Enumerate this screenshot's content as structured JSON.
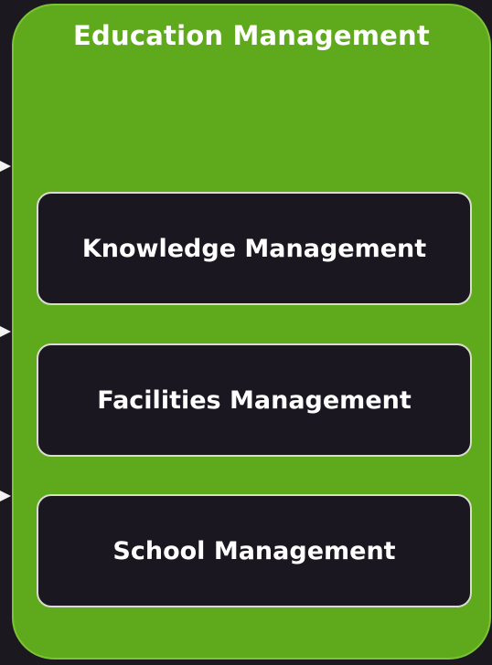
{
  "group": {
    "title": "Education Management",
    "modules": [
      {
        "label": "Knowledge Management"
      },
      {
        "label": "Facilities Management"
      },
      {
        "label": "School Management"
      }
    ]
  },
  "colors": {
    "background": "#1c1820",
    "group_fill": "#5fa91c",
    "module_fill": "#1a1721",
    "module_border": "#d9dccf",
    "text": "#ffffff"
  }
}
